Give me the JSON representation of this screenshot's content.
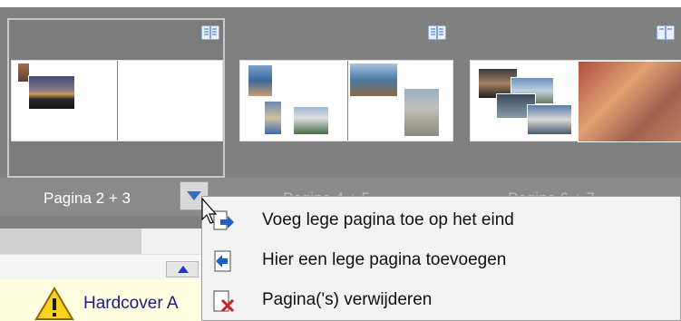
{
  "gallery": {
    "spreads": [
      {
        "label": "Pagina 2 + 3",
        "selected": true
      },
      {
        "label": "Pagina 4 + 5",
        "selected": false
      },
      {
        "label": "Pagina 6 + 7",
        "selected": false
      }
    ],
    "menu_button_icon": "dropdown-arrow-icon",
    "book_icon": "open-book-icon"
  },
  "context_menu": {
    "items": [
      {
        "label": "Voeg lege pagina toe op het eind",
        "icon": "page-append-icon"
      },
      {
        "label": "Hier een lege pagina toevoegen",
        "icon": "page-insert-icon"
      },
      {
        "label": "Pagina('s) verwijderen",
        "icon": "page-delete-icon"
      }
    ]
  },
  "warning": {
    "text": "Hardcover A",
    "icon": "warning-triangle-icon"
  },
  "colors": {
    "gallery_bg": "#808080",
    "warning_bg": "#fffee0",
    "warning_text": "#1a1a8a",
    "icon_blue": "#1e5fc8",
    "delete_red": "#d21e1e"
  }
}
